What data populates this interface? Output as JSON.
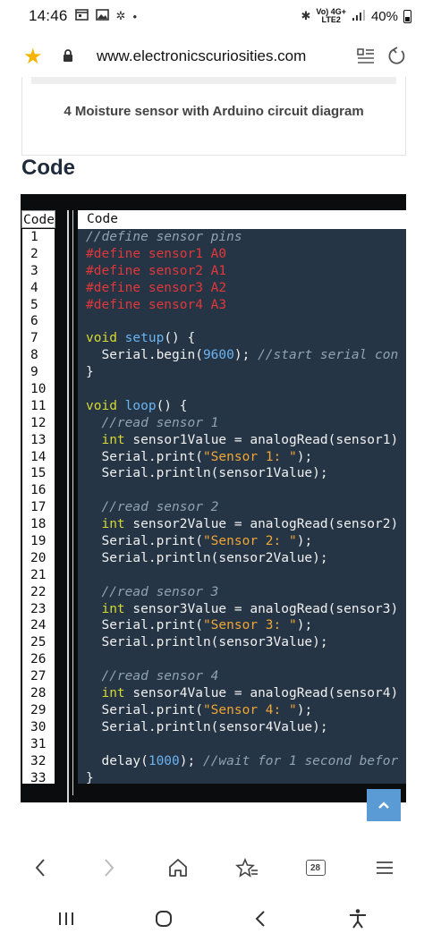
{
  "status_bar": {
    "time": "14:46",
    "network_top": "Vo) 4G+",
    "network_bottom": "LTE2",
    "battery": "40%"
  },
  "address_bar": {
    "url": "www.electronicscuriosities.com"
  },
  "page": {
    "figure_caption": "4 Moisture sensor with Arduino circuit diagram",
    "section_heading": "Code",
    "table_headers": {
      "line_col": "Code",
      "code_col": "Code"
    }
  },
  "code_lines": [
    [
      {
        "t": "//define sensor pins",
        "c": "cmt"
      }
    ],
    [
      {
        "t": "#define sensor1 A0",
        "c": "pp"
      }
    ],
    [
      {
        "t": "#define sensor2 A1",
        "c": "pp"
      }
    ],
    [
      {
        "t": "#define sensor3 A2",
        "c": "pp"
      }
    ],
    [
      {
        "t": "#define sensor4 A3",
        "c": "pp"
      }
    ],
    [],
    [
      {
        "t": "void",
        "c": "kw"
      },
      {
        "t": " ",
        "c": "txt"
      },
      {
        "t": "setup",
        "c": "fn"
      },
      {
        "t": "() {",
        "c": "txt"
      }
    ],
    [
      {
        "t": "  Serial.begin(",
        "c": "txt"
      },
      {
        "t": "9600",
        "c": "num"
      },
      {
        "t": "); ",
        "c": "txt"
      },
      {
        "t": "//start serial con",
        "c": "cmt"
      }
    ],
    [
      {
        "t": "}",
        "c": "txt"
      }
    ],
    [],
    [
      {
        "t": "void",
        "c": "kw"
      },
      {
        "t": " ",
        "c": "txt"
      },
      {
        "t": "loop",
        "c": "fn"
      },
      {
        "t": "() {",
        "c": "txt"
      }
    ],
    [
      {
        "t": "  //read sensor 1",
        "c": "cmt"
      }
    ],
    [
      {
        "t": "  ",
        "c": "txt"
      },
      {
        "t": "int",
        "c": "kw"
      },
      {
        "t": " sensor1Value = analogRead(sensor1)",
        "c": "txt"
      }
    ],
    [
      {
        "t": "  Serial.print(",
        "c": "txt"
      },
      {
        "t": "\"Sensor 1: \"",
        "c": "str"
      },
      {
        "t": ");",
        "c": "txt"
      }
    ],
    [
      {
        "t": "  Serial.println(sensor1Value);",
        "c": "txt"
      }
    ],
    [],
    [
      {
        "t": "  //read sensor 2",
        "c": "cmt"
      }
    ],
    [
      {
        "t": "  ",
        "c": "txt"
      },
      {
        "t": "int",
        "c": "kw"
      },
      {
        "t": " sensor2Value = analogRead(sensor2)",
        "c": "txt"
      }
    ],
    [
      {
        "t": "  Serial.print(",
        "c": "txt"
      },
      {
        "t": "\"Sensor 2: \"",
        "c": "str"
      },
      {
        "t": ");",
        "c": "txt"
      }
    ],
    [
      {
        "t": "  Serial.println(sensor2Value);",
        "c": "txt"
      }
    ],
    [],
    [
      {
        "t": "  //read sensor 3",
        "c": "cmt"
      }
    ],
    [
      {
        "t": "  ",
        "c": "txt"
      },
      {
        "t": "int",
        "c": "kw"
      },
      {
        "t": " sensor3Value = analogRead(sensor3)",
        "c": "txt"
      }
    ],
    [
      {
        "t": "  Serial.print(",
        "c": "txt"
      },
      {
        "t": "\"Sensor 3: \"",
        "c": "str"
      },
      {
        "t": ");",
        "c": "txt"
      }
    ],
    [
      {
        "t": "  Serial.println(sensor3Value);",
        "c": "txt"
      }
    ],
    [],
    [
      {
        "t": "  //read sensor 4",
        "c": "cmt"
      }
    ],
    [
      {
        "t": "  ",
        "c": "txt"
      },
      {
        "t": "int",
        "c": "kw"
      },
      {
        "t": " sensor4Value = analogRead(sensor4)",
        "c": "txt"
      }
    ],
    [
      {
        "t": "  Serial.print(",
        "c": "txt"
      },
      {
        "t": "\"Sensor 4: \"",
        "c": "str"
      },
      {
        "t": ");",
        "c": "txt"
      }
    ],
    [
      {
        "t": "  Serial.println(sensor4Value);",
        "c": "txt"
      }
    ],
    [],
    [
      {
        "t": "  delay(",
        "c": "txt"
      },
      {
        "t": "1000",
        "c": "num"
      },
      {
        "t": "); ",
        "c": "txt"
      },
      {
        "t": "//wait for 1 second befor",
        "c": "cmt"
      }
    ],
    [
      {
        "t": "}",
        "c": "txt"
      }
    ]
  ],
  "toolbar": {
    "tab_count": "28",
    "icons": [
      "back-icon",
      "forward-icon",
      "home-icon",
      "bookmarks-icon",
      "tabs-icon",
      "menu-icon"
    ]
  },
  "nav_bar": {
    "icons": [
      "recents-icon",
      "home-circle-icon",
      "nav-back-icon",
      "accessibility-icon"
    ]
  },
  "colors": {
    "code_bg": "#263545",
    "keyword": "#d5d932",
    "preprocessor": "#e0383a",
    "function": "#6ab4f2",
    "string": "#f0a634",
    "comment": "#8fa3b5",
    "scroll_button": "#5b9bd5",
    "bookmark_star": "#f5b400"
  }
}
